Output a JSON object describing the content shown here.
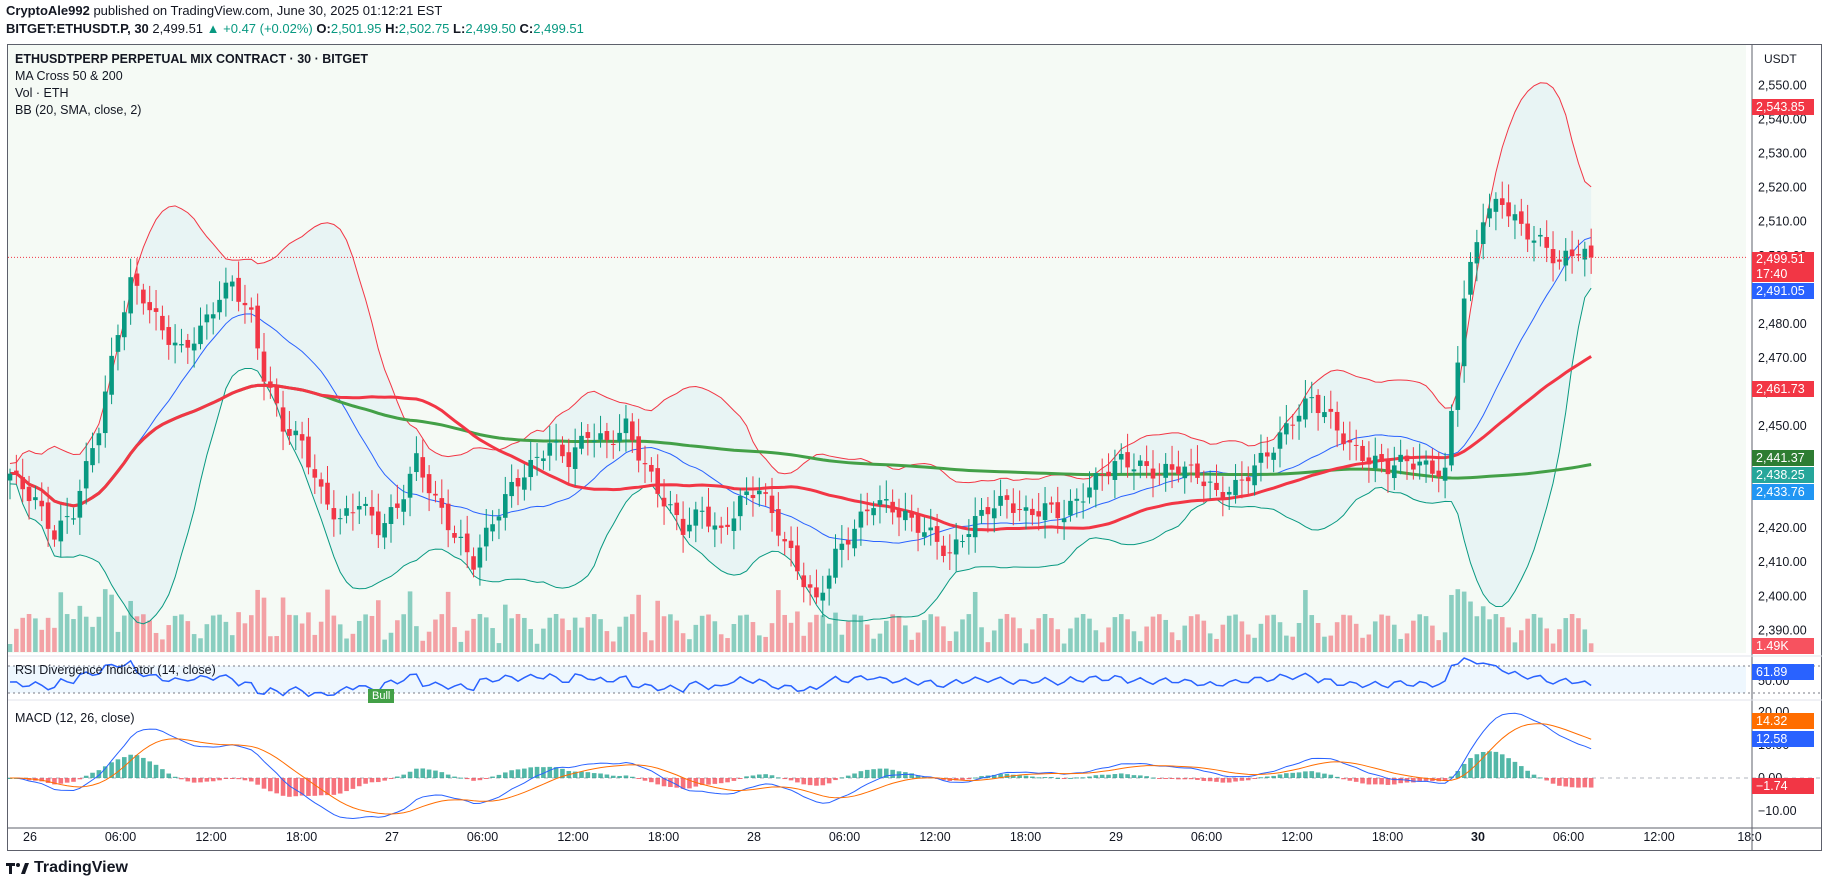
{
  "header": {
    "line1_author": "CryptoAle992",
    "line1_rest": "published on TradingView.com, June 30, 2025 01:12:21 EST",
    "symbol": "BITGET:ETHUSDT.P, 30",
    "last": "2,499.51",
    "change": "▲ +0.47 (+0.02%)",
    "o_label": "O:",
    "o": "2,501.95",
    "h_label": "H:",
    "h": "2,502.75",
    "l_label": "L:",
    "l": "2,499.50",
    "c_label": "C:",
    "c": "2,499.51"
  },
  "legend": {
    "title": "ETHUSDTPERP PERPETUAL MIX CONTRACT · 30 · BITGET",
    "ma": "MA Cross 50 & 200",
    "vol": "Vol · ETH",
    "bb": "BB (20, SMA, close, 2)",
    "rsi": "RSI Divergence Indicator (14, close)",
    "macd": "MACD (12, 26, close)",
    "bull_label": "Bull"
  },
  "scale": {
    "currency": "USDT",
    "price_ticks": [
      "2,550.00",
      "2,540.00",
      "2,530.00",
      "2,520.00",
      "2,510.00",
      "2,500.00",
      "2,490.00",
      "2,480.00",
      "2,470.00",
      "2,460.00",
      "2,450.00",
      "2,440.00",
      "2,430.00",
      "2,420.00",
      "2,410.00",
      "2,400.00",
      "2,390.00"
    ],
    "rsi_tick": "50.00",
    "macd_ticks": [
      "20.00",
      "10.00",
      "0.00",
      "−10.00"
    ]
  },
  "tags": {
    "bb_upper": "2,543.85",
    "price": "2,499.51",
    "countdown": "17:40",
    "bb_basis": "2,491.05",
    "ma50": "2,461.73",
    "ma200": "2,441.37",
    "price2": "2,438.25",
    "bb_lower": "2,433.76",
    "volume": "1.49K",
    "rsi": "61.89",
    "macd_signal": "14.32",
    "macd": "12.58",
    "macd_hist": "−1.74"
  },
  "time_axis": [
    "26",
    "06:00",
    "12:00",
    "18:00",
    "27",
    "06:00",
    "12:00",
    "18:00",
    "28",
    "06:00",
    "12:00",
    "18:00",
    "29",
    "06:00",
    "12:00",
    "18:00",
    "30",
    "06:00",
    "12:00",
    "18:0"
  ],
  "brand": "TradingView",
  "colors": {
    "up": "#089981",
    "down": "#f23645",
    "ma50": "#f23645",
    "ma200": "#43a047",
    "bb_basis": "#2962ff",
    "bb_upper": "#f23645",
    "bb_lower": "#089981",
    "rsi": "#2962ff",
    "macd": "#2962ff",
    "signal": "#ff6d00"
  },
  "chart_data": {
    "type": "candlestick",
    "title": "ETHUSDTPERP PERPETUAL MIX CONTRACT · 30 · BITGET",
    "interval_minutes": 30,
    "ylim": [
      2385,
      2556
    ],
    "close_path": [
      [
        0,
        2436
      ],
      [
        4,
        2428
      ],
      [
        7,
        2418
      ],
      [
        10,
        2425
      ],
      [
        14,
        2450
      ],
      [
        17,
        2478
      ],
      [
        19,
        2492
      ],
      [
        21,
        2488
      ],
      [
        24,
        2478
      ],
      [
        27,
        2472
      ],
      [
        30,
        2478
      ],
      [
        33,
        2488
      ],
      [
        35,
        2492
      ],
      [
        38,
        2482
      ],
      [
        40,
        2465
      ],
      [
        43,
        2450
      ],
      [
        46,
        2445
      ],
      [
        49,
        2430
      ],
      [
        52,
        2422
      ],
      [
        55,
        2428
      ],
      [
        58,
        2420
      ],
      [
        61,
        2426
      ],
      [
        64,
        2440
      ],
      [
        67,
        2428
      ],
      [
        70,
        2418
      ],
      [
        73,
        2410
      ],
      [
        76,
        2422
      ],
      [
        79,
        2432
      ],
      [
        82,
        2438
      ],
      [
        85,
        2445
      ],
      [
        88,
        2440
      ],
      [
        91,
        2448
      ],
      [
        94,
        2445
      ],
      [
        97,
        2450
      ],
      [
        100,
        2438
      ],
      [
        103,
        2428
      ],
      [
        106,
        2420
      ],
      [
        109,
        2425
      ],
      [
        112,
        2418
      ],
      [
        115,
        2428
      ],
      [
        118,
        2432
      ],
      [
        121,
        2420
      ],
      [
        124,
        2408
      ],
      [
        127,
        2398
      ],
      [
        130,
        2412
      ],
      [
        133,
        2420
      ],
      [
        136,
        2428
      ],
      [
        139,
        2426
      ],
      [
        142,
        2422
      ],
      [
        145,
        2418
      ],
      [
        148,
        2412
      ],
      [
        151,
        2420
      ],
      [
        154,
        2426
      ],
      [
        157,
        2428
      ],
      [
        160,
        2424
      ],
      [
        163,
        2426
      ],
      [
        166,
        2424
      ],
      [
        169,
        2430
      ],
      [
        172,
        2436
      ],
      [
        175,
        2440
      ],
      [
        178,
        2438
      ],
      [
        181,
        2436
      ],
      [
        184,
        2438
      ],
      [
        187,
        2436
      ],
      [
        190,
        2430
      ],
      [
        193,
        2432
      ],
      [
        196,
        2438
      ],
      [
        199,
        2444
      ],
      [
        202,
        2452
      ],
      [
        205,
        2458
      ],
      [
        208,
        2452
      ],
      [
        211,
        2444
      ],
      [
        214,
        2440
      ],
      [
        217,
        2438
      ],
      [
        220,
        2440
      ],
      [
        223,
        2438
      ],
      [
        226,
        2436
      ],
      [
        229,
        2488
      ],
      [
        232,
        2512
      ],
      [
        235,
        2516
      ],
      [
        238,
        2508
      ],
      [
        241,
        2504
      ],
      [
        244,
        2498
      ],
      [
        247,
        2502
      ],
      [
        249,
        2499.5
      ]
    ],
    "bollinger_20_2_sma": {
      "upper_last": 2543.85,
      "basis_last": 2491.05,
      "lower_last": 2433.76
    },
    "ma_cross_50_200": {
      "ma50_last": 2461.73,
      "ma200_last": 2441.37
    },
    "volume_last": "1.49K",
    "rsi_14": {
      "last": 61.89,
      "level": 50
    },
    "macd_12_26": {
      "macd": 12.58,
      "signal": 14.32,
      "histogram": -1.74,
      "ylim": [
        -12,
        22
      ]
    },
    "annotations": [
      "Bull"
    ],
    "last": {
      "open": 2501.95,
      "high": 2502.75,
      "low": 2499.5,
      "close": 2499.51,
      "change": 0.47,
      "change_pct": 0.02
    }
  }
}
